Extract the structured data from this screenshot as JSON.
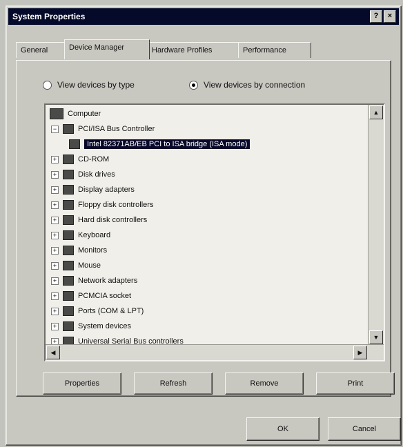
{
  "window": {
    "title": "System Properties",
    "controls": [
      "?",
      "×"
    ]
  },
  "tabs": [
    {
      "label": "General"
    },
    {
      "label": "Device Manager"
    },
    {
      "label": "Hardware Profiles"
    },
    {
      "label": "Performance"
    }
  ],
  "view": {
    "by_type_label": "View devices by type",
    "by_connection_label": "View devices by connection",
    "selected": "by_connection"
  },
  "tree": {
    "root": "Computer",
    "items": [
      {
        "label": "PCI/ISA Bus Controller",
        "selected": false
      },
      {
        "label": "Intel 82371AB/EB PCI to ISA bridge (ISA mode)",
        "selected": true
      },
      {
        "label": "CD-ROM",
        "selected": false
      },
      {
        "label": "Disk drives",
        "selected": false
      },
      {
        "label": "Display adapters",
        "selected": false
      },
      {
        "label": "Floppy disk controllers",
        "selected": false
      },
      {
        "label": "Hard disk controllers",
        "selected": false
      },
      {
        "label": "Keyboard",
        "selected": false
      },
      {
        "label": "Monitors",
        "selected": false
      },
      {
        "label": "Mouse",
        "selected": false
      },
      {
        "label": "Network adapters",
        "selected": false
      },
      {
        "label": "PCMCIA socket",
        "selected": false
      },
      {
        "label": "Ports (COM & LPT)",
        "selected": false
      },
      {
        "label": "System devices",
        "selected": false
      },
      {
        "label": "Universal Serial Bus controllers",
        "selected": false
      }
    ]
  },
  "buttons": {
    "properties": "Properties",
    "refresh": "Refresh",
    "remove": "Remove",
    "print": "Print",
    "ok": "OK",
    "cancel": "Cancel"
  }
}
